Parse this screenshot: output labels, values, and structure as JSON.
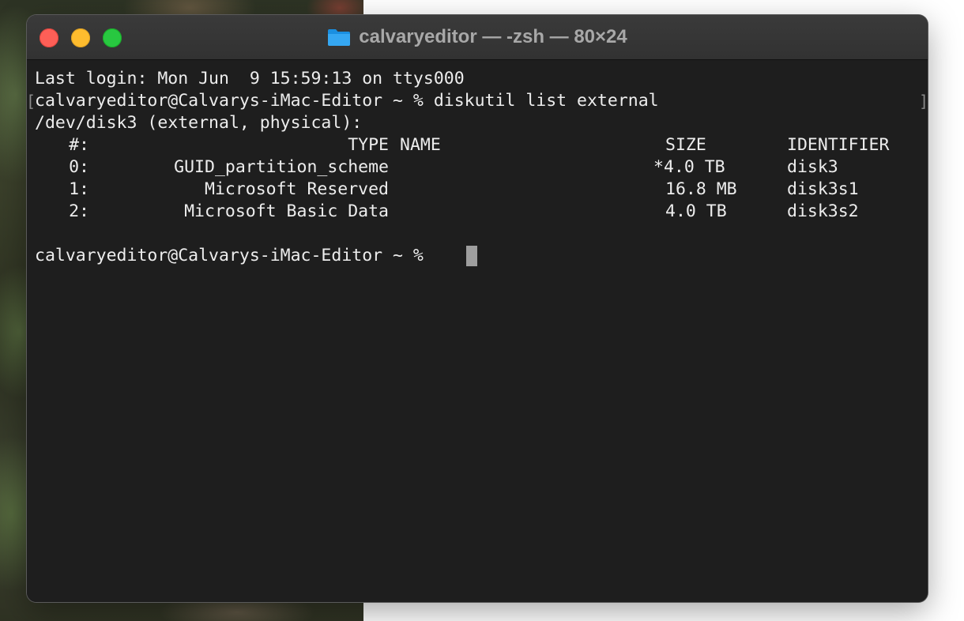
{
  "window": {
    "title": "calvaryeditor — -zsh — 80×24",
    "folder_icon": "folder-icon",
    "colors": {
      "close": "#fe5f57",
      "minimize": "#febc2e",
      "zoom": "#28c840",
      "background": "#1e1e1e",
      "text": "#ededed"
    }
  },
  "terminal": {
    "last_login": "Last login: Mon Jun  9 15:59:13 on ttys000",
    "command_line": "calvaryeditor@Calvarys-iMac-Editor ~ % diskutil list external",
    "disk_header": "/dev/disk3 (external, physical):",
    "columns": {
      "index": "#:",
      "type": "TYPE",
      "name": "NAME",
      "size": "SIZE",
      "identifier": "IDENTIFIER"
    },
    "partitions": [
      {
        "index": "0:",
        "type": "GUID_partition_scheme",
        "size": "*4.0 TB",
        "identifier": "disk3"
      },
      {
        "index": "1:",
        "type": "Microsoft Reserved",
        "size": "16.8 MB",
        "identifier": "disk3s1"
      },
      {
        "index": "2:",
        "type": "Microsoft Basic Data",
        "size": "4.0 TB",
        "identifier": "disk3s2"
      }
    ],
    "prompt": "calvaryeditor@Calvarys-iMac-Editor ~ %"
  }
}
